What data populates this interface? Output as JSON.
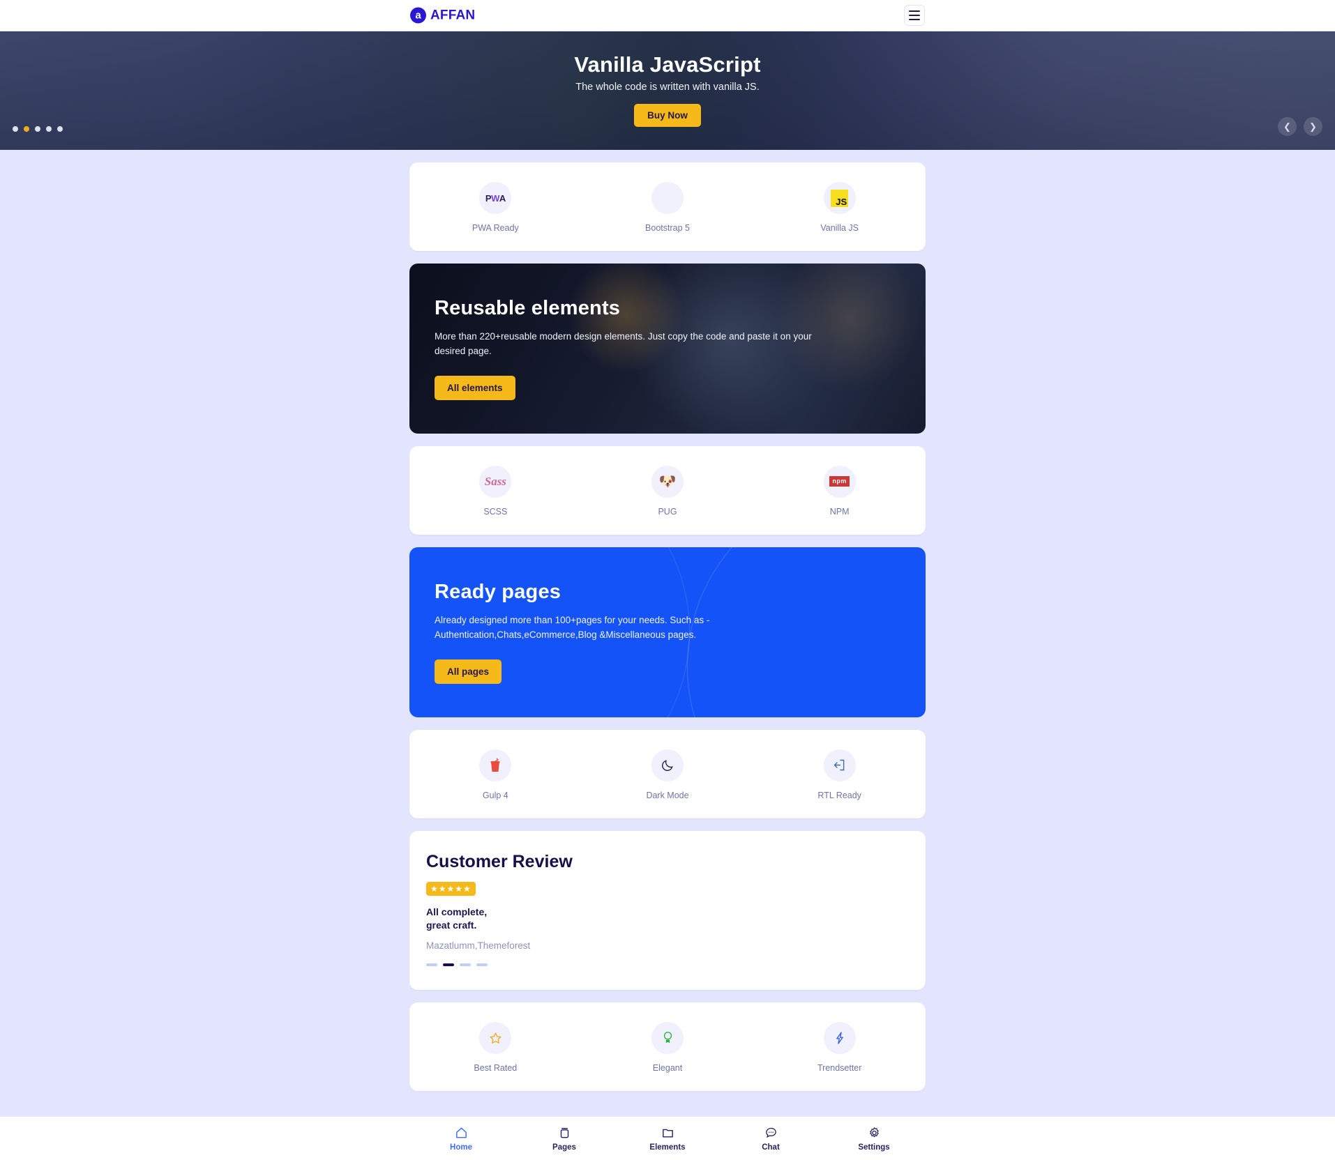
{
  "header": {
    "brand_mark": "a",
    "brand_name": "AFFAN",
    "menu_icon": "hamburger-icon"
  },
  "hero": {
    "title": "Vanilla JavaScript",
    "subtitle": "The whole code is written with vanilla JS.",
    "cta_label": "Buy Now",
    "dots_total": 5,
    "dot_active_index": 1,
    "prev_icon": "chevron-left-icon",
    "next_icon": "chevron-right-icon"
  },
  "features_row1": [
    {
      "label": "PWA Ready",
      "icon": "pwa-icon"
    },
    {
      "label": "Bootstrap 5",
      "icon": "bootstrap-icon"
    },
    {
      "label": "Vanilla JS",
      "icon": "javascript-icon"
    }
  ],
  "banner_elements": {
    "title": "Reusable elements",
    "text": "More than 220+reusable modern design elements. Just copy the code and paste it on your desired page.",
    "cta_label": "All elements"
  },
  "features_row2": [
    {
      "label": "SCSS",
      "icon": "sass-icon"
    },
    {
      "label": "PUG",
      "icon": "pug-dog-icon"
    },
    {
      "label": "NPM",
      "icon": "npm-icon"
    }
  ],
  "banner_pages": {
    "title": "Ready pages",
    "text": "Already designed more than 100+pages for your needs. Such as -Authentication,Chats,eCommerce,Blog &Miscellaneous pages.",
    "cta_label": "All pages"
  },
  "features_row3": [
    {
      "label": "Gulp 4",
      "icon": "gulp-cup-icon"
    },
    {
      "label": "Dark Mode",
      "icon": "moon-icon"
    },
    {
      "label": "RTL Ready",
      "icon": "rtl-arrow-icon"
    }
  ],
  "review": {
    "title": "Customer Review",
    "stars": "★★★★★",
    "rating": 5,
    "quote_line1": "All complete,",
    "quote_line2": "great craft.",
    "author": "Mazatlumm,Themeforest",
    "dots_total": 4,
    "dot_active_index": 1
  },
  "features_row4": [
    {
      "label": "Best Rated",
      "icon": "star-outline-icon"
    },
    {
      "label": "Elegant",
      "icon": "award-ribbon-icon"
    },
    {
      "label": "Trendsetter",
      "icon": "lightning-bolt-icon"
    }
  ],
  "bottom_nav": [
    {
      "label": "Home",
      "icon": "home-icon",
      "active": true
    },
    {
      "label": "Pages",
      "icon": "pages-icon",
      "active": false
    },
    {
      "label": "Elements",
      "icon": "folder-icon",
      "active": false
    },
    {
      "label": "Chat",
      "icon": "chat-bubble-icon",
      "active": false
    },
    {
      "label": "Settings",
      "icon": "gear-icon",
      "active": false
    }
  ],
  "colors": {
    "page_bg": "#e2e5fd",
    "brand": "#2a17d6",
    "accent_yellow": "#f5b919",
    "accent_blue": "#1353f7",
    "nav_active": "#3d6ef5"
  }
}
